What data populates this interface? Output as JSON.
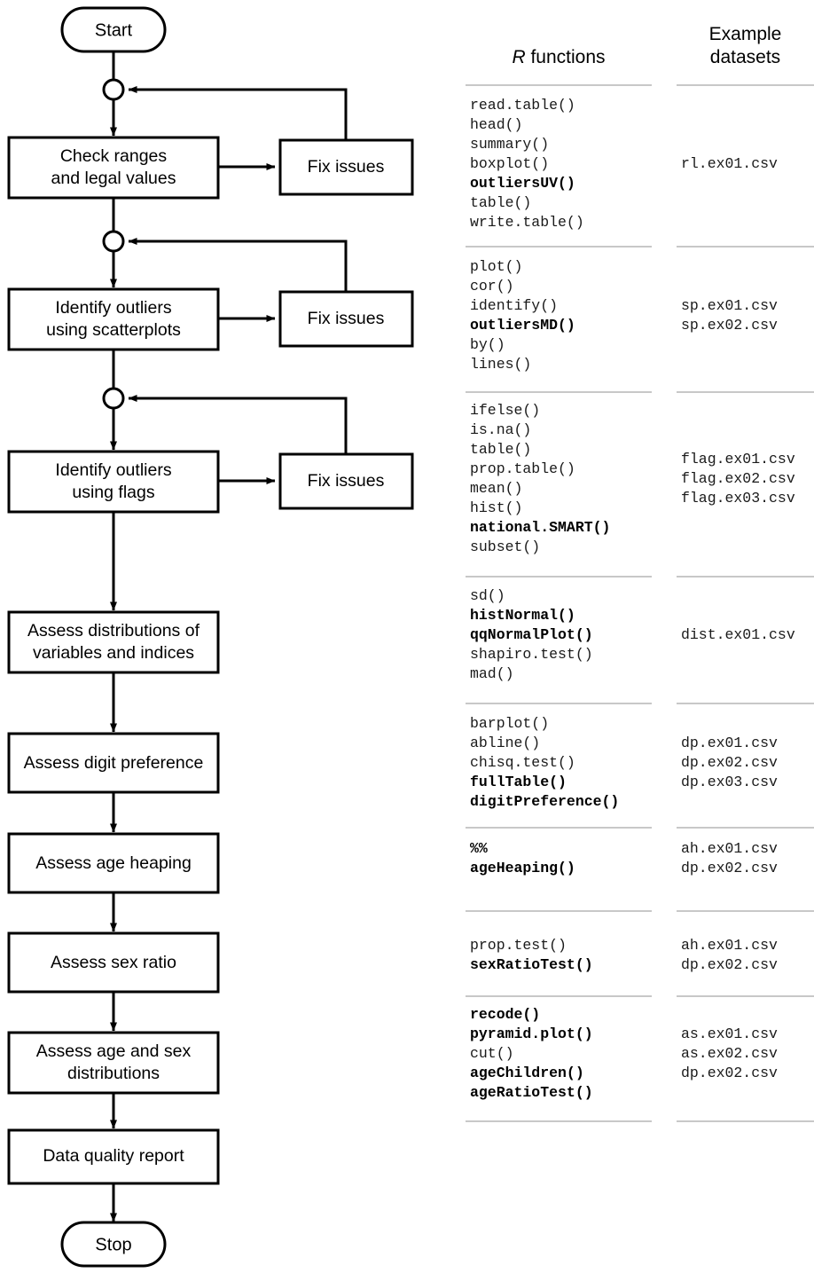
{
  "flowchart": {
    "nodes": [
      {
        "id": "start",
        "type": "terminal",
        "label": "Start"
      },
      {
        "id": "check-ranges",
        "type": "process",
        "label_line1": "Check ranges",
        "label_line2": "and legal values"
      },
      {
        "id": "fix-issues-1",
        "type": "process",
        "label_line1": "Fix issues"
      },
      {
        "id": "outliers-scatter",
        "type": "process",
        "label_line1": "Identify outliers",
        "label_line2": "using scatterplots"
      },
      {
        "id": "fix-issues-2",
        "type": "process",
        "label_line1": "Fix issues"
      },
      {
        "id": "outliers-flags",
        "type": "process",
        "label_line1": "Identify outliers",
        "label_line2": "using flags"
      },
      {
        "id": "fix-issues-3",
        "type": "process",
        "label_line1": "Fix issues"
      },
      {
        "id": "assess-distributions",
        "type": "process",
        "label_line1": "Assess distributions of",
        "label_line2": "variables and indices"
      },
      {
        "id": "assess-digit-preference",
        "type": "process",
        "label_line1": "Assess digit preference"
      },
      {
        "id": "assess-age-heaping",
        "type": "process",
        "label_line1": "Assess age heaping"
      },
      {
        "id": "assess-sex-ratio",
        "type": "process",
        "label_line1": "Assess sex ratio"
      },
      {
        "id": "assess-age-sex",
        "type": "process",
        "label_line1": "Assess age and sex",
        "label_line2": "distributions"
      },
      {
        "id": "data-quality-report",
        "type": "process",
        "label_line1": "Data quality report"
      },
      {
        "id": "stop",
        "type": "terminal",
        "label": "Stop"
      }
    ],
    "labels": {
      "start": "Start",
      "stop": "Stop",
      "check_ranges_l1": "Check ranges",
      "check_ranges_l2": "and legal values",
      "fix_issues_1": "Fix issues",
      "fix_issues_2": "Fix issues",
      "fix_issues_3": "Fix issues",
      "outliers_scatter_l1": "Identify outliers",
      "outliers_scatter_l2": "using scatterplots",
      "outliers_flags_l1": "Identify outliers",
      "outliers_flags_l2": "using flags",
      "distributions_l1": "Assess distributions of",
      "distributions_l2": "variables and indices",
      "digit_preference": "Assess digit preference",
      "age_heaping": "Assess age heaping",
      "sex_ratio": "Assess sex ratio",
      "age_sex_l1": "Assess age and sex",
      "age_sex_l2": "distributions",
      "report": "Data quality report"
    },
    "colors": {
      "stroke": "#000000",
      "fill": "#ffffff"
    }
  },
  "reference": {
    "headers": {
      "functions_italic": "R",
      "functions_rest": " functions",
      "datasets_line1": "Example",
      "datasets_line2": "datasets"
    },
    "groups": [
      {
        "id": "ranges-legal-values",
        "functions": [
          {
            "name": "read.table()",
            "bold": false
          },
          {
            "name": "head()",
            "bold": false
          },
          {
            "name": "summary()",
            "bold": false
          },
          {
            "name": "boxplot()",
            "bold": false
          },
          {
            "name": "outliersUV()",
            "bold": true
          },
          {
            "name": "table()",
            "bold": false
          },
          {
            "name": "write.table()",
            "bold": false
          }
        ],
        "datasets": [
          "rl.ex01.csv"
        ]
      },
      {
        "id": "scatterplots",
        "functions": [
          {
            "name": "plot()",
            "bold": false
          },
          {
            "name": "cor()",
            "bold": false
          },
          {
            "name": "identify()",
            "bold": false
          },
          {
            "name": "outliersMD()",
            "bold": true
          },
          {
            "name": "by()",
            "bold": false
          },
          {
            "name": "lines()",
            "bold": false
          }
        ],
        "datasets": [
          "sp.ex01.csv",
          "sp.ex02.csv"
        ]
      },
      {
        "id": "flags",
        "functions": [
          {
            "name": "ifelse()",
            "bold": false
          },
          {
            "name": "is.na()",
            "bold": false
          },
          {
            "name": "table()",
            "bold": false
          },
          {
            "name": "prop.table()",
            "bold": false
          },
          {
            "name": "mean()",
            "bold": false
          },
          {
            "name": "hist()",
            "bold": false
          },
          {
            "name": "national.SMART()",
            "bold": true
          },
          {
            "name": "subset()",
            "bold": false
          }
        ],
        "datasets": [
          "flag.ex01.csv",
          "flag.ex02.csv",
          "flag.ex03.csv"
        ]
      },
      {
        "id": "distributions",
        "functions": [
          {
            "name": "sd()",
            "bold": false
          },
          {
            "name": "histNormal()",
            "bold": true
          },
          {
            "name": "qqNormalPlot()",
            "bold": true
          },
          {
            "name": "shapiro.test()",
            "bold": false
          },
          {
            "name": "mad()",
            "bold": false
          }
        ],
        "datasets": [
          "dist.ex01.csv"
        ]
      },
      {
        "id": "digit-preference",
        "functions": [
          {
            "name": "barplot()",
            "bold": false
          },
          {
            "name": "abline()",
            "bold": false
          },
          {
            "name": "chisq.test()",
            "bold": false
          },
          {
            "name": "fullTable()",
            "bold": true
          },
          {
            "name": "digitPreference()",
            "bold": true
          }
        ],
        "datasets": [
          "dp.ex01.csv",
          "dp.ex02.csv",
          "dp.ex03.csv"
        ]
      },
      {
        "id": "age-heaping",
        "functions": [
          {
            "name": "%%",
            "bold": true
          },
          {
            "name": "ageHeaping()",
            "bold": true
          }
        ],
        "datasets": [
          "ah.ex01.csv",
          "dp.ex02.csv"
        ]
      },
      {
        "id": "sex-ratio",
        "functions": [
          {
            "name": "prop.test()",
            "bold": false
          },
          {
            "name": "sexRatioTest()",
            "bold": true
          }
        ],
        "datasets": [
          "ah.ex01.csv",
          "dp.ex02.csv"
        ]
      },
      {
        "id": "age-sex-distributions",
        "functions": [
          {
            "name": "recode()",
            "bold": true
          },
          {
            "name": "pyramid.plot()",
            "bold": true
          },
          {
            "name": "cut()",
            "bold": false
          },
          {
            "name": "ageChildren()",
            "bold": true
          },
          {
            "name": "ageRatioTest()",
            "bold": true
          }
        ],
        "datasets": [
          "as.ex01.csv",
          "as.ex02.csv",
          "dp.ex02.csv"
        ]
      }
    ]
  }
}
